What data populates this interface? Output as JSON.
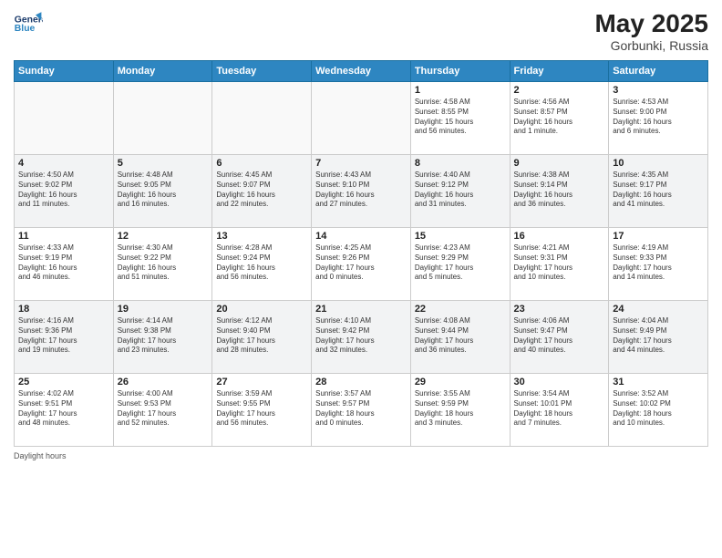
{
  "header": {
    "logo_line1": "General",
    "logo_line2": "Blue",
    "month_year": "May 2025",
    "location": "Gorbunki, Russia"
  },
  "days_of_week": [
    "Sunday",
    "Monday",
    "Tuesday",
    "Wednesday",
    "Thursday",
    "Friday",
    "Saturday"
  ],
  "weeks": [
    [
      {
        "day": "",
        "info": ""
      },
      {
        "day": "",
        "info": ""
      },
      {
        "day": "",
        "info": ""
      },
      {
        "day": "",
        "info": ""
      },
      {
        "day": "1",
        "info": "Sunrise: 4:58 AM\nSunset: 8:55 PM\nDaylight: 15 hours\nand 56 minutes."
      },
      {
        "day": "2",
        "info": "Sunrise: 4:56 AM\nSunset: 8:57 PM\nDaylight: 16 hours\nand 1 minute."
      },
      {
        "day": "3",
        "info": "Sunrise: 4:53 AM\nSunset: 9:00 PM\nDaylight: 16 hours\nand 6 minutes."
      }
    ],
    [
      {
        "day": "4",
        "info": "Sunrise: 4:50 AM\nSunset: 9:02 PM\nDaylight: 16 hours\nand 11 minutes."
      },
      {
        "day": "5",
        "info": "Sunrise: 4:48 AM\nSunset: 9:05 PM\nDaylight: 16 hours\nand 16 minutes."
      },
      {
        "day": "6",
        "info": "Sunrise: 4:45 AM\nSunset: 9:07 PM\nDaylight: 16 hours\nand 22 minutes."
      },
      {
        "day": "7",
        "info": "Sunrise: 4:43 AM\nSunset: 9:10 PM\nDaylight: 16 hours\nand 27 minutes."
      },
      {
        "day": "8",
        "info": "Sunrise: 4:40 AM\nSunset: 9:12 PM\nDaylight: 16 hours\nand 31 minutes."
      },
      {
        "day": "9",
        "info": "Sunrise: 4:38 AM\nSunset: 9:14 PM\nDaylight: 16 hours\nand 36 minutes."
      },
      {
        "day": "10",
        "info": "Sunrise: 4:35 AM\nSunset: 9:17 PM\nDaylight: 16 hours\nand 41 minutes."
      }
    ],
    [
      {
        "day": "11",
        "info": "Sunrise: 4:33 AM\nSunset: 9:19 PM\nDaylight: 16 hours\nand 46 minutes."
      },
      {
        "day": "12",
        "info": "Sunrise: 4:30 AM\nSunset: 9:22 PM\nDaylight: 16 hours\nand 51 minutes."
      },
      {
        "day": "13",
        "info": "Sunrise: 4:28 AM\nSunset: 9:24 PM\nDaylight: 16 hours\nand 56 minutes."
      },
      {
        "day": "14",
        "info": "Sunrise: 4:25 AM\nSunset: 9:26 PM\nDaylight: 17 hours\nand 0 minutes."
      },
      {
        "day": "15",
        "info": "Sunrise: 4:23 AM\nSunset: 9:29 PM\nDaylight: 17 hours\nand 5 minutes."
      },
      {
        "day": "16",
        "info": "Sunrise: 4:21 AM\nSunset: 9:31 PM\nDaylight: 17 hours\nand 10 minutes."
      },
      {
        "day": "17",
        "info": "Sunrise: 4:19 AM\nSunset: 9:33 PM\nDaylight: 17 hours\nand 14 minutes."
      }
    ],
    [
      {
        "day": "18",
        "info": "Sunrise: 4:16 AM\nSunset: 9:36 PM\nDaylight: 17 hours\nand 19 minutes."
      },
      {
        "day": "19",
        "info": "Sunrise: 4:14 AM\nSunset: 9:38 PM\nDaylight: 17 hours\nand 23 minutes."
      },
      {
        "day": "20",
        "info": "Sunrise: 4:12 AM\nSunset: 9:40 PM\nDaylight: 17 hours\nand 28 minutes."
      },
      {
        "day": "21",
        "info": "Sunrise: 4:10 AM\nSunset: 9:42 PM\nDaylight: 17 hours\nand 32 minutes."
      },
      {
        "day": "22",
        "info": "Sunrise: 4:08 AM\nSunset: 9:44 PM\nDaylight: 17 hours\nand 36 minutes."
      },
      {
        "day": "23",
        "info": "Sunrise: 4:06 AM\nSunset: 9:47 PM\nDaylight: 17 hours\nand 40 minutes."
      },
      {
        "day": "24",
        "info": "Sunrise: 4:04 AM\nSunset: 9:49 PM\nDaylight: 17 hours\nand 44 minutes."
      }
    ],
    [
      {
        "day": "25",
        "info": "Sunrise: 4:02 AM\nSunset: 9:51 PM\nDaylight: 17 hours\nand 48 minutes."
      },
      {
        "day": "26",
        "info": "Sunrise: 4:00 AM\nSunset: 9:53 PM\nDaylight: 17 hours\nand 52 minutes."
      },
      {
        "day": "27",
        "info": "Sunrise: 3:59 AM\nSunset: 9:55 PM\nDaylight: 17 hours\nand 56 minutes."
      },
      {
        "day": "28",
        "info": "Sunrise: 3:57 AM\nSunset: 9:57 PM\nDaylight: 18 hours\nand 0 minutes."
      },
      {
        "day": "29",
        "info": "Sunrise: 3:55 AM\nSunset: 9:59 PM\nDaylight: 18 hours\nand 3 minutes."
      },
      {
        "day": "30",
        "info": "Sunrise: 3:54 AM\nSunset: 10:01 PM\nDaylight: 18 hours\nand 7 minutes."
      },
      {
        "day": "31",
        "info": "Sunrise: 3:52 AM\nSunset: 10:02 PM\nDaylight: 18 hours\nand 10 minutes."
      }
    ]
  ],
  "footer": {
    "note": "Daylight hours"
  }
}
